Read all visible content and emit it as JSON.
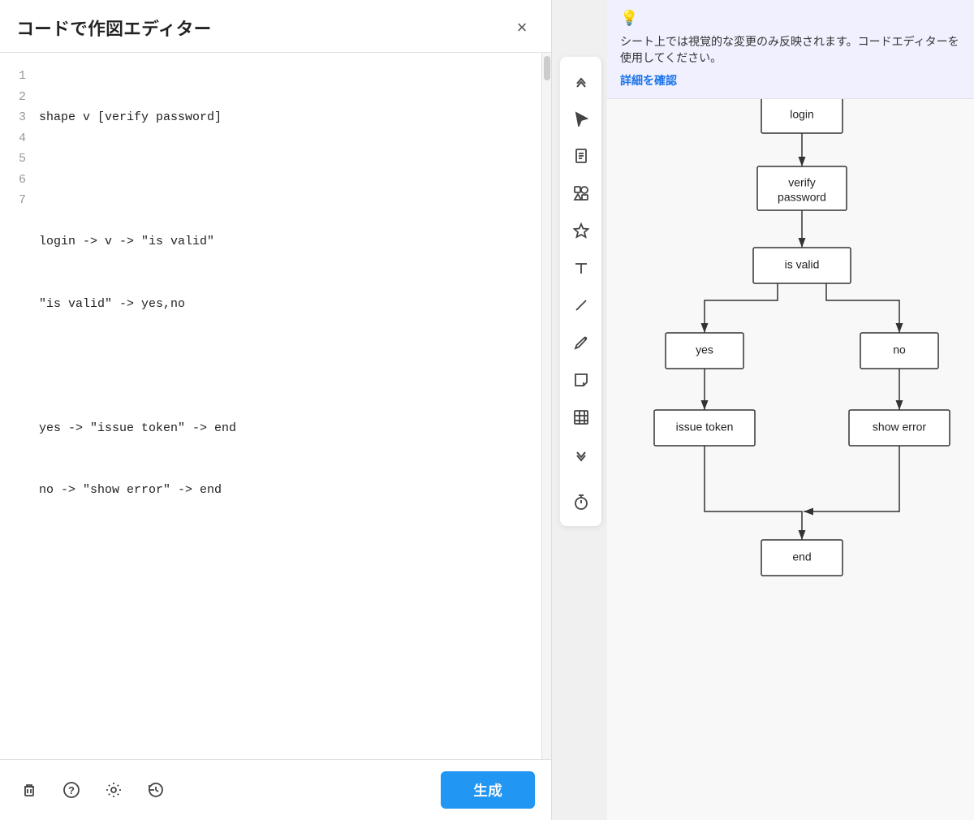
{
  "editor": {
    "title": "コードで作図エディター",
    "close_label": "×",
    "lines": [
      {
        "num": "1",
        "text": "shape v [verify password]"
      },
      {
        "num": "2",
        "text": ""
      },
      {
        "num": "3",
        "text": "login -> v -> \"is valid\""
      },
      {
        "num": "4",
        "text": "\"is valid\" -> yes,no"
      },
      {
        "num": "5",
        "text": ""
      },
      {
        "num": "6",
        "text": "yes -> \"issue token\" -> end"
      },
      {
        "num": "7",
        "text": "no -> \"show error\" -> end"
      }
    ],
    "generate_button": "生成"
  },
  "footer_icons": {
    "trash": "🗑",
    "help": "?",
    "settings": "⚙",
    "history": "🕐"
  },
  "toolbar": {
    "items": [
      {
        "name": "chevron-up-icon",
        "symbol": "⌃",
        "label": "up"
      },
      {
        "name": "cursor-icon",
        "symbol": "↖",
        "label": "cursor"
      },
      {
        "name": "document-icon",
        "symbol": "≡",
        "label": "document"
      },
      {
        "name": "shapes-icon",
        "symbol": "◈",
        "label": "shapes"
      },
      {
        "name": "star-icon",
        "symbol": "☆",
        "label": "star"
      },
      {
        "name": "text-icon",
        "symbol": "T",
        "label": "text"
      },
      {
        "name": "line-icon",
        "symbol": "/",
        "label": "line"
      },
      {
        "name": "pen-icon",
        "symbol": "✏",
        "label": "pen"
      },
      {
        "name": "sticky-icon",
        "symbol": "▭",
        "label": "sticky"
      },
      {
        "name": "table-icon",
        "symbol": "⊞",
        "label": "table"
      },
      {
        "name": "chevron-down-icon",
        "symbol": "⌄",
        "label": "down"
      }
    ]
  },
  "info_banner": {
    "text": "シート上では視覚的な変更のみ反映されます。コードエディターを使用してください。",
    "link_text": "詳細を確認"
  },
  "flowchart": {
    "nodes": {
      "login": "login",
      "verify_password": "verify\npassword",
      "is_valid": "is valid",
      "yes": "yes",
      "no": "no",
      "issue_token": "issue token",
      "show_error": "show error",
      "end": "end"
    }
  },
  "timer_icon": "⏱"
}
